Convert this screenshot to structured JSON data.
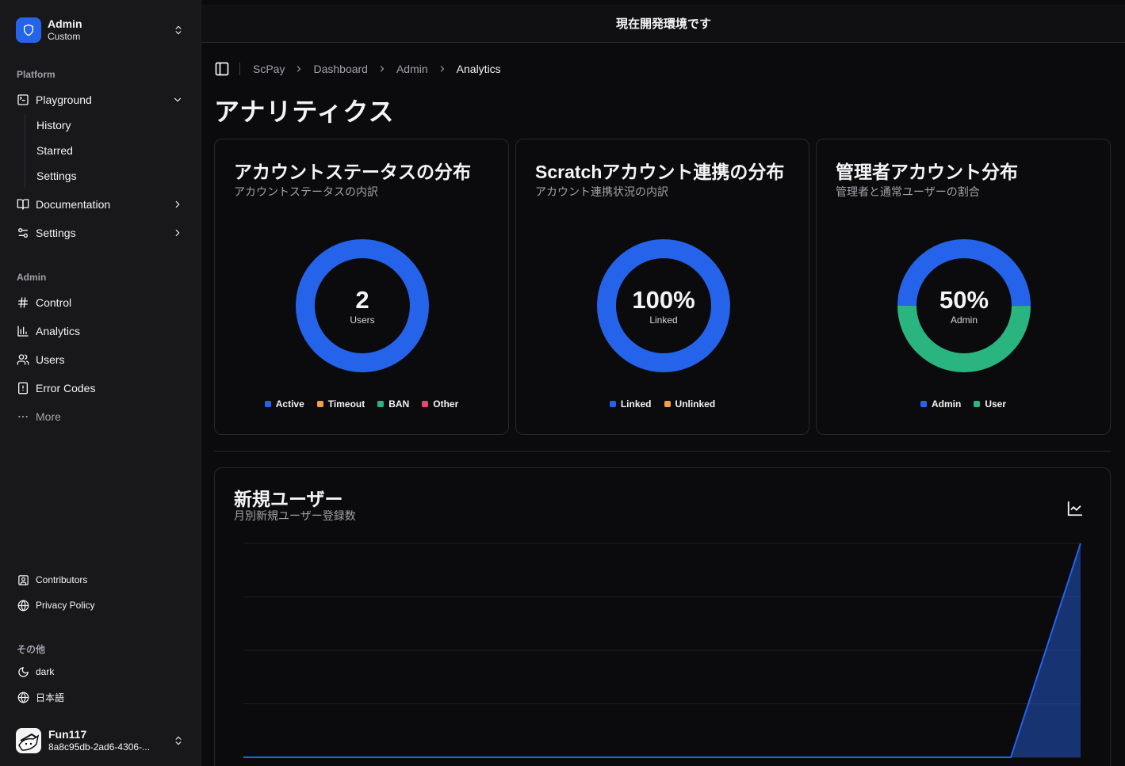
{
  "sidebar": {
    "team": {
      "name": "Admin",
      "plan": "Custom"
    },
    "platform_label": "Platform",
    "platform_items": [
      {
        "label": "Playground",
        "icon": "terminal-square-icon"
      },
      {
        "label": "Documentation",
        "icon": "book-open-icon"
      },
      {
        "label": "Settings",
        "icon": "settings-sliders-icon"
      }
    ],
    "playground_sub": [
      "History",
      "Starred",
      "Settings"
    ],
    "admin_label": "Admin",
    "admin_items": [
      {
        "label": "Control",
        "icon": "hash-icon"
      },
      {
        "label": "Analytics",
        "icon": "bar-chart-icon"
      },
      {
        "label": "Users",
        "icon": "users-icon"
      },
      {
        "label": "Error Codes",
        "icon": "file-warning-icon"
      },
      {
        "label": "More",
        "icon": "more-horizontal-icon"
      }
    ],
    "secondary_items": [
      {
        "label": "Contributors",
        "icon": "contact-icon"
      },
      {
        "label": "Privacy Policy",
        "icon": "globe-lock-icon"
      }
    ],
    "other_label": "その他",
    "other_items": [
      {
        "label": "dark",
        "icon": "moon-icon"
      },
      {
        "label": "日本語",
        "icon": "globe-icon"
      }
    ],
    "user": {
      "name": "Fun117",
      "id": "8a8c95db-2ad6-4306-..."
    }
  },
  "banner": "現在開発環境です",
  "breadcrumb": [
    "ScPay",
    "Dashboard",
    "Admin",
    "Analytics"
  ],
  "page_title": "アナリティクス",
  "cards": [
    {
      "title": "アカウントステータスの分布",
      "description": "アカウントステータスの内訳",
      "center_value": "2",
      "center_label": "Users",
      "legend": [
        {
          "label": "Active",
          "color": "#2563eb"
        },
        {
          "label": "Timeout",
          "color": "#f59e42"
        },
        {
          "label": "BAN",
          "color": "#2ab47f"
        },
        {
          "label": "Other",
          "color": "#e8466c"
        }
      ],
      "segments": [
        {
          "fraction": 1.0,
          "color": "#2563eb"
        }
      ]
    },
    {
      "title": "Scratchアカウント連携の分布",
      "description": "アカウント連携状況の内訳",
      "center_value": "100%",
      "center_label": "Linked",
      "legend": [
        {
          "label": "Linked",
          "color": "#2563eb"
        },
        {
          "label": "Unlinked",
          "color": "#f59e42"
        }
      ],
      "segments": [
        {
          "fraction": 1.0,
          "color": "#2563eb"
        }
      ]
    },
    {
      "title": "管理者アカウント分布",
      "description": "管理者と通常ユーザーの割合",
      "center_value": "50%",
      "center_label": "Admin",
      "legend": [
        {
          "label": "Admin",
          "color": "#2563eb"
        },
        {
          "label": "User",
          "color": "#2ab47f"
        }
      ],
      "segments": [
        {
          "fraction": 0.5,
          "color": "#2563eb"
        },
        {
          "fraction": 0.5,
          "color": "#2ab47f"
        }
      ]
    }
  ],
  "new_users": {
    "title": "新規ユーザー",
    "description": "月別新規ユーザー登録数",
    "icon": "line-chart-icon"
  },
  "chart_data": {
    "type": "area",
    "title": "新規ユーザー",
    "subtitle": "月別新規ユーザー登録数",
    "x": [
      0,
      1,
      2,
      3,
      4,
      5,
      6,
      7,
      8,
      9,
      10,
      11,
      12
    ],
    "series": [
      {
        "values": [
          0,
          0,
          0,
          0,
          0,
          0,
          0,
          0,
          0,
          0,
          0,
          0,
          2
        ],
        "color": "#2563eb"
      }
    ],
    "ylim": [
      0,
      2
    ],
    "grid": true
  },
  "colors": {
    "accent": "#2563eb",
    "green": "#2ab47f",
    "orange": "#f59e42",
    "pink": "#e8466c"
  }
}
